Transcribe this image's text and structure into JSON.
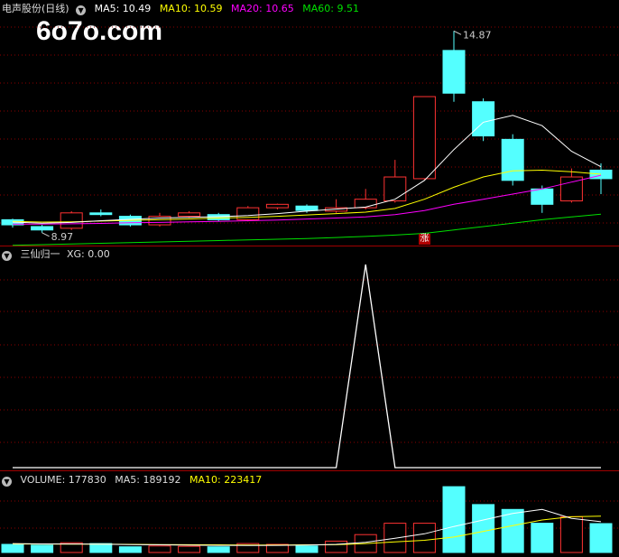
{
  "price_header": {
    "name": "电声股份(日线)",
    "ma5": "MA5: 10.49",
    "ma10": "MA10: 10.59",
    "ma20": "MA20: 10.65",
    "ma60": "MA60: 9.51"
  },
  "indicator_header": {
    "name": "三仙归一",
    "xg": "XG: 0.00"
  },
  "volume_header": {
    "volume": "VOLUME: 177830",
    "ma5": "MA5: 189192",
    "ma10": "MA10: 223417"
  },
  "watermark": "6o7o.com",
  "marker_label": "涨",
  "colors": {
    "up": "#ff3232",
    "down": "#54ffff",
    "ma5": "#ffffff",
    "ma10": "#ffff00",
    "ma20": "#ff00ff",
    "ma60": "#00e000",
    "grid": "#8b0000",
    "xg": "#ffffff"
  },
  "chart_data": [
    {
      "type": "candlestick",
      "title": "电声股份(日线)",
      "ylim": [
        8.7,
        15.3
      ],
      "annotations": [
        {
          "label": "14.87",
          "value": 14.87,
          "index": 15
        },
        {
          "label": "8.97",
          "value": 8.97,
          "index": 1
        }
      ],
      "candles": [
        {
          "open": 9.35,
          "close": 9.2,
          "high": 9.38,
          "low": 9.12
        },
        {
          "open": 9.15,
          "close": 9.05,
          "high": 9.2,
          "low": 8.97
        },
        {
          "open": 9.1,
          "close": 9.55,
          "high": 9.6,
          "low": 9.05
        },
        {
          "open": 9.55,
          "close": 9.5,
          "high": 9.65,
          "low": 9.45
        },
        {
          "open": 9.45,
          "close": 9.2,
          "high": 9.5,
          "low": 9.15
        },
        {
          "open": 9.2,
          "close": 9.45,
          "high": 9.55,
          "low": 9.15
        },
        {
          "open": 9.45,
          "close": 9.55,
          "high": 9.6,
          "low": 9.4
        },
        {
          "open": 9.5,
          "close": 9.35,
          "high": 9.55,
          "low": 9.3
        },
        {
          "open": 9.35,
          "close": 9.7,
          "high": 9.75,
          "low": 9.3
        },
        {
          "open": 9.7,
          "close": 9.8,
          "high": 9.82,
          "low": 9.65
        },
        {
          "open": 9.75,
          "close": 9.62,
          "high": 9.8,
          "low": 9.55
        },
        {
          "open": 9.6,
          "close": 9.7,
          "high": 9.95,
          "low": 9.55
        },
        {
          "open": 9.7,
          "close": 9.95,
          "high": 10.25,
          "low": 9.65
        },
        {
          "open": 9.9,
          "close": 10.6,
          "high": 11.1,
          "low": 9.85
        },
        {
          "open": 10.55,
          "close": 12.95,
          "high": 12.95,
          "low": 10.5
        },
        {
          "open": 14.3,
          "close": 13.05,
          "high": 14.87,
          "low": 12.8
        },
        {
          "open": 12.8,
          "close": 11.8,
          "high": 12.9,
          "low": 11.65
        },
        {
          "open": 11.7,
          "close": 10.5,
          "high": 11.85,
          "low": 10.35
        },
        {
          "open": 10.25,
          "close": 9.8,
          "high": 10.35,
          "low": 9.55
        },
        {
          "open": 9.9,
          "close": 10.6,
          "high": 10.85,
          "low": 9.85
        },
        {
          "open": 10.8,
          "close": 10.55,
          "high": 11.0,
          "low": 10.1
        }
      ],
      "ma5": [
        9.28,
        9.25,
        9.27,
        9.32,
        9.36,
        9.4,
        9.42,
        9.44,
        9.47,
        9.53,
        9.6,
        9.66,
        9.72,
        9.95,
        10.5,
        11.4,
        12.2,
        12.4,
        12.1,
        11.35,
        10.9
      ],
      "ma10": [
        9.3,
        9.28,
        9.29,
        9.31,
        9.33,
        9.35,
        9.37,
        9.4,
        9.42,
        9.45,
        9.49,
        9.53,
        9.57,
        9.68,
        9.95,
        10.3,
        10.6,
        10.78,
        10.8,
        10.75,
        10.68
      ],
      "ma20": [
        9.22,
        9.22,
        9.23,
        9.24,
        9.26,
        9.27,
        9.29,
        9.3,
        9.32,
        9.34,
        9.37,
        9.4,
        9.43,
        9.5,
        9.62,
        9.8,
        9.95,
        10.1,
        10.25,
        10.45,
        10.65
      ],
      "ma60": [
        8.6,
        8.62,
        8.64,
        8.66,
        8.68,
        8.7,
        8.72,
        8.74,
        8.76,
        8.78,
        8.8,
        8.83,
        8.86,
        8.9,
        8.95,
        9.05,
        9.15,
        9.25,
        9.35,
        9.43,
        9.51
      ]
    },
    {
      "type": "line",
      "title": "三仙归一",
      "ylim": [
        0,
        1
      ],
      "series": [
        {
          "name": "XG",
          "values": [
            0,
            0,
            0,
            0,
            0,
            0,
            0,
            0,
            0,
            0,
            0,
            0,
            1,
            0,
            0,
            0,
            0,
            0,
            0,
            0,
            0
          ]
        }
      ]
    },
    {
      "type": "bar",
      "title": "VOLUME",
      "ylim": [
        0,
        400000
      ],
      "values": [
        50000,
        45000,
        60000,
        55000,
        35000,
        40000,
        38000,
        35000,
        55000,
        50000,
        40000,
        70000,
        110000,
        180000,
        180000,
        405000,
        295000,
        265000,
        180000,
        220000,
        177830
      ],
      "ma5": [
        55000,
        53000,
        52000,
        51000,
        49000,
        47000,
        45000,
        44000,
        43000,
        44000,
        46000,
        50000,
        62000,
        88000,
        115000,
        160000,
        200000,
        240000,
        265000,
        210000,
        189192
      ],
      "ma10": [
        52000,
        52000,
        51000,
        51000,
        50000,
        49000,
        48000,
        47000,
        46000,
        46000,
        47000,
        48000,
        55000,
        65000,
        75000,
        95000,
        130000,
        165000,
        200000,
        220000,
        223417
      ]
    }
  ]
}
